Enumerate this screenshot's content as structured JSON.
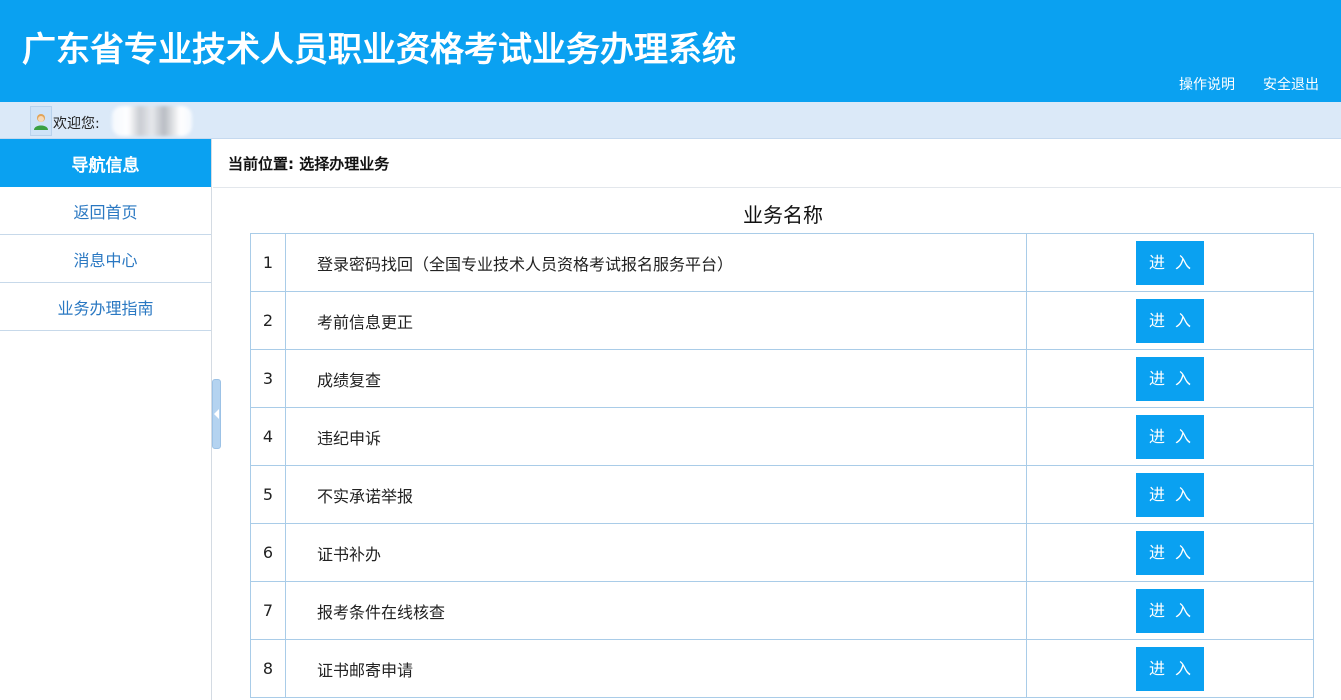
{
  "header": {
    "title": "广东省专业技术人员职业资格考试业务办理系统",
    "links": [
      "操作说明",
      "安全退出"
    ]
  },
  "welcome": {
    "label": "欢迎您:",
    "icon": "user-avatar-icon"
  },
  "sidebar": {
    "title": "导航信息",
    "items": [
      {
        "label": "返回首页"
      },
      {
        "label": "消息中心"
      },
      {
        "label": "业务办理指南"
      }
    ]
  },
  "main": {
    "breadcrumb": "当前位置: 选择办理业务",
    "table_title": "业务名称",
    "rows": [
      {
        "num": "1",
        "name": "登录密码找回（全国专业技术人员资格考试报名服务平台）",
        "action": "进入"
      },
      {
        "num": "2",
        "name": "考前信息更正",
        "action": "进入"
      },
      {
        "num": "3",
        "name": "成绩复查",
        "action": "进入"
      },
      {
        "num": "4",
        "name": "违纪申诉",
        "action": "进入"
      },
      {
        "num": "5",
        "name": "不实承诺举报",
        "action": "进入"
      },
      {
        "num": "6",
        "name": "证书补办",
        "action": "进入"
      },
      {
        "num": "7",
        "name": "报考条件在线核查",
        "action": "进入"
      },
      {
        "num": "8",
        "name": "证书邮寄申请",
        "action": "进入"
      }
    ]
  },
  "colors": {
    "brand": "#0aa1f1",
    "welcome_bar": "#dbe9f8",
    "nav_link": "#2a78c2",
    "table_border": "#a9cce8"
  }
}
